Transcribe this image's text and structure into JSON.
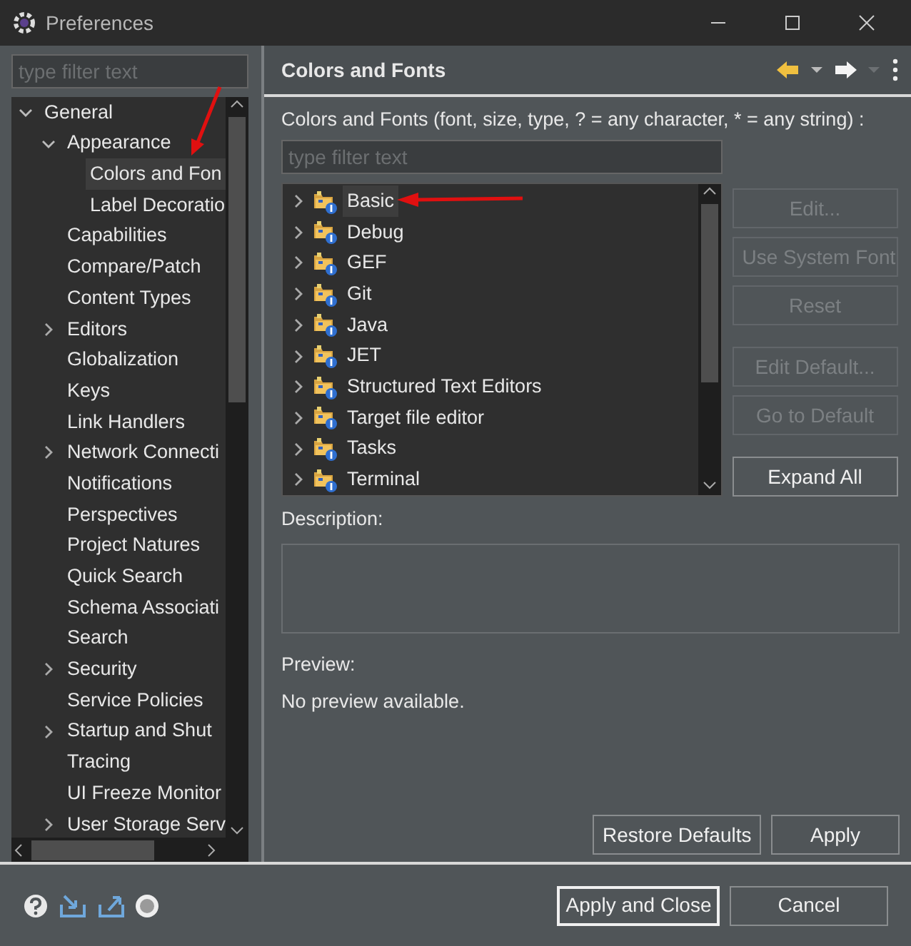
{
  "window": {
    "title": "Preferences"
  },
  "sidebar": {
    "filter_placeholder": "type filter text",
    "items": [
      {
        "label": "General",
        "expanded": true,
        "selected": false,
        "children": [
          {
            "label": "Appearance",
            "expanded": true,
            "selected": false,
            "children": [
              {
                "label": "Colors and Fon",
                "selected": true
              },
              {
                "label": "Label Decoratio",
                "selected": false
              }
            ]
          },
          {
            "label": "Capabilities",
            "selected": false
          },
          {
            "label": "Compare/Patch",
            "selected": false
          },
          {
            "label": "Content Types",
            "selected": false
          },
          {
            "label": "Editors",
            "expanded": false,
            "selected": false
          },
          {
            "label": "Globalization",
            "selected": false
          },
          {
            "label": "Keys",
            "selected": false
          },
          {
            "label": "Link Handlers",
            "selected": false
          },
          {
            "label": "Network Connecti",
            "expanded": false,
            "selected": false
          },
          {
            "label": "Notifications",
            "selected": false
          },
          {
            "label": "Perspectives",
            "selected": false
          },
          {
            "label": "Project Natures",
            "selected": false
          },
          {
            "label": "Quick Search",
            "selected": false
          },
          {
            "label": "Schema Associati",
            "selected": false
          },
          {
            "label": "Search",
            "selected": false
          },
          {
            "label": "Security",
            "expanded": false,
            "selected": false
          },
          {
            "label": "Service Policies",
            "selected": false
          },
          {
            "label": "Startup and Shut",
            "expanded": false,
            "selected": false
          },
          {
            "label": "Tracing",
            "selected": false
          },
          {
            "label": "UI Freeze Monitor",
            "selected": false
          },
          {
            "label": "User Storage Serv",
            "expanded": false,
            "selected": false
          }
        ]
      }
    ]
  },
  "page": {
    "title": "Colors and Fonts",
    "filter_label": "Colors and Fonts (font, size, type, ? = any character, * = any string) :",
    "filter_placeholder": "type filter text",
    "tree": [
      {
        "label": "Basic",
        "selected": true
      },
      {
        "label": "Debug",
        "selected": false
      },
      {
        "label": "GEF",
        "selected": false
      },
      {
        "label": "Git",
        "selected": false
      },
      {
        "label": "Java",
        "selected": false
      },
      {
        "label": "JET",
        "selected": false
      },
      {
        "label": "Structured Text Editors",
        "selected": false
      },
      {
        "label": "Target file editor",
        "selected": false
      },
      {
        "label": "Tasks",
        "selected": false
      },
      {
        "label": "Terminal",
        "selected": false
      }
    ],
    "side_buttons": [
      {
        "label": "Edit...",
        "disabled": true
      },
      {
        "label": "Use System Font",
        "disabled": true
      },
      {
        "label": "Reset",
        "disabled": true
      },
      {
        "label": "Edit Default...",
        "disabled": true
      },
      {
        "label": "Go to Default",
        "disabled": true
      },
      {
        "label": "Expand All",
        "disabled": false
      }
    ],
    "description_label": "Description:",
    "preview_label": "Preview:",
    "preview_text": "No preview available.",
    "page_buttons": [
      "Restore Defaults",
      "Apply"
    ]
  },
  "footer_buttons": [
    {
      "label": "Apply and Close",
      "default": true
    },
    {
      "label": "Cancel",
      "default": false
    }
  ]
}
